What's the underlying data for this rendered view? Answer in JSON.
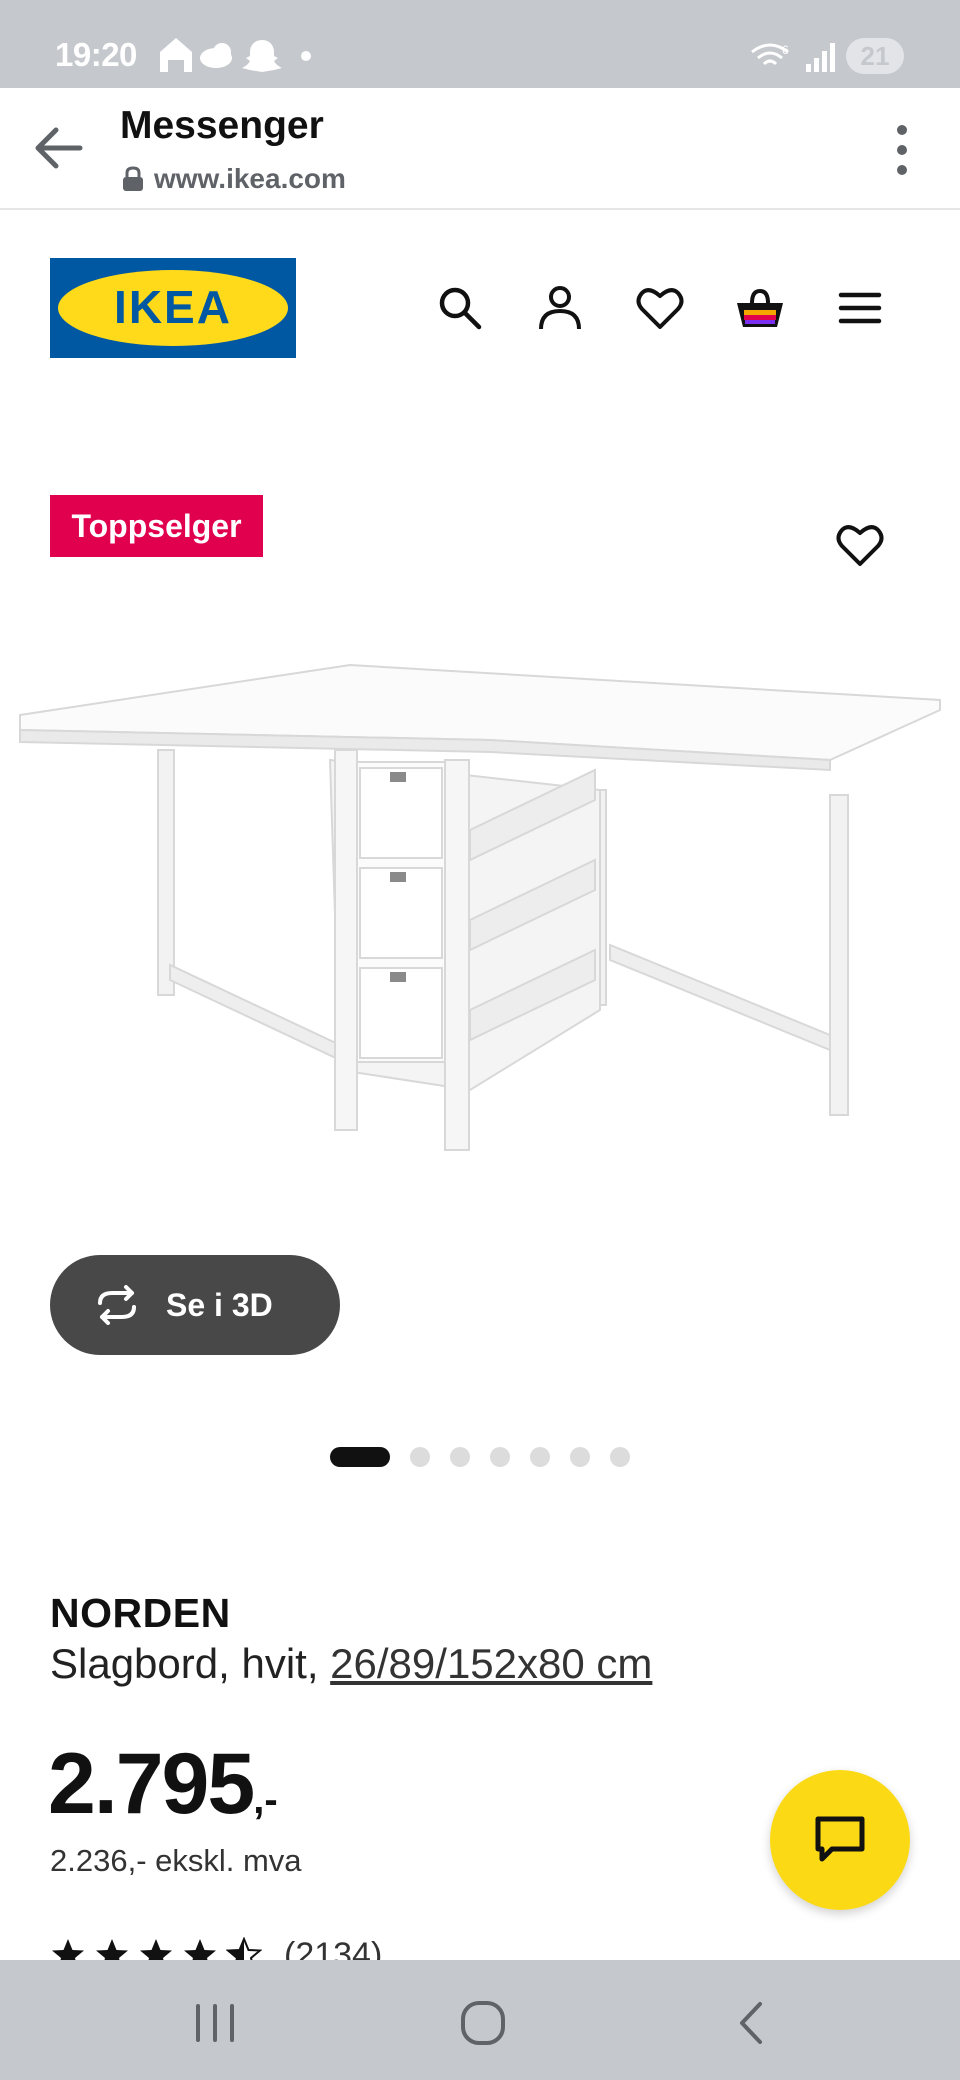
{
  "status_bar": {
    "time": "19:20",
    "battery": "21",
    "left_icons": [
      "home-icon",
      "cloud-icon",
      "snapchat-icon",
      "dot-icon"
    ],
    "right_icons": [
      "wifi-icon",
      "signal-icon",
      "battery-icon"
    ]
  },
  "browser": {
    "title": "Messenger",
    "url": "www.ikea.com"
  },
  "header": {
    "logo_text": "IKEA",
    "logo_colors": {
      "blue": "#0058a3",
      "yellow": "#ffda1a"
    },
    "icons": [
      "search-icon",
      "account-icon",
      "heart-icon",
      "basket-icon",
      "menu-icon"
    ]
  },
  "product": {
    "badge": "Toppselger",
    "badge_color": "#e0004d",
    "view_3d_label": "Se i 3D",
    "carousel": {
      "total": 7,
      "active": 1
    },
    "name": "NORDEN",
    "desc_prefix": "Slagbord, hvit, ",
    "desc_measure": "26/89/152x80 cm",
    "price_main": "2.795",
    "price_suffix": ",-",
    "price_ex_vat": "2.236,- ekskl. mva",
    "rating": {
      "stars": 4.5,
      "count": "(2134)"
    }
  },
  "chat": {
    "icon": "chat-icon",
    "color": "#fbd914"
  },
  "nav_bar": {
    "buttons": [
      "recent-apps-icon",
      "home-circle-icon",
      "back-chevron-icon"
    ]
  }
}
